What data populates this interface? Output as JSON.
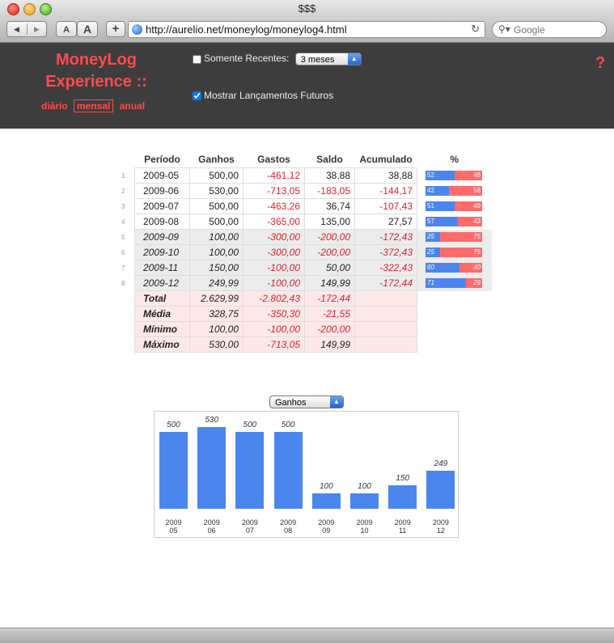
{
  "window": {
    "title": "$$$"
  },
  "toolbar": {
    "text_small": "A",
    "text_large": "A",
    "add_label": "+",
    "url": "http://aurelio.net/moneylog/moneylog4.html",
    "search_placeholder": "Google"
  },
  "header": {
    "logo_line1": "MoneyLog",
    "logo_line2": "Experience ::",
    "views": [
      "diário",
      "mensal",
      "anual"
    ],
    "active_view": "mensal",
    "recent_label": "Somente Recentes:",
    "recent_checked": false,
    "recent_value": "3 meses",
    "future_label": "Mostrar Lançamentos Futuros",
    "future_checked": true,
    "help": "?"
  },
  "table": {
    "headers": [
      "Período",
      "Ganhos",
      "Gastos",
      "Saldo",
      "Acumulado",
      "%"
    ],
    "rows": [
      {
        "n": "1",
        "period": "2009-05",
        "ganhos": "500,00",
        "gastos": "-461,12",
        "saldo": "38,88",
        "acumulado": "38,88",
        "g_pct": 52,
        "s_pct": 48,
        "future": false
      },
      {
        "n": "2",
        "period": "2009-06",
        "ganhos": "530,00",
        "gastos": "-713,05",
        "saldo": "-183,05",
        "acumulado": "-144,17",
        "g_pct": 42,
        "s_pct": 58,
        "future": false
      },
      {
        "n": "3",
        "period": "2009-07",
        "ganhos": "500,00",
        "gastos": "-463,26",
        "saldo": "36,74",
        "acumulado": "-107,43",
        "g_pct": 51,
        "s_pct": 49,
        "future": false
      },
      {
        "n": "4",
        "period": "2009-08",
        "ganhos": "500,00",
        "gastos": "-365,00",
        "saldo": "135,00",
        "acumulado": "27,57",
        "g_pct": 57,
        "s_pct": 43,
        "future": false
      },
      {
        "n": "5",
        "period": "2009-09",
        "ganhos": "100,00",
        "gastos": "-300,00",
        "saldo": "-200,00",
        "acumulado": "-172,43",
        "g_pct": 25,
        "s_pct": 75,
        "future": true
      },
      {
        "n": "6",
        "period": "2009-10",
        "ganhos": "100,00",
        "gastos": "-300,00",
        "saldo": "-200,00",
        "acumulado": "-372,43",
        "g_pct": 25,
        "s_pct": 75,
        "future": true
      },
      {
        "n": "7",
        "period": "2009-11",
        "ganhos": "150,00",
        "gastos": "-100,00",
        "saldo": "50,00",
        "acumulado": "-322,43",
        "g_pct": 60,
        "s_pct": 40,
        "future": true
      },
      {
        "n": "8",
        "period": "2009-12",
        "ganhos": "249,99",
        "gastos": "-100,00",
        "saldo": "149,99",
        "acumulado": "-172,44",
        "g_pct": 71,
        "s_pct": 29,
        "future": true
      }
    ],
    "summary": [
      {
        "label": "Total",
        "ganhos": "2.629,99",
        "gastos": "-2.802,43",
        "saldo": "-172,44"
      },
      {
        "label": "Média",
        "ganhos": "328,75",
        "gastos": "-350,30",
        "saldo": "-21,55"
      },
      {
        "label": "Mínimo",
        "ganhos": "100,00",
        "gastos": "-100,00",
        "saldo": "-200,00"
      },
      {
        "label": "Máximo",
        "ganhos": "530,00",
        "gastos": "-713,05",
        "saldo": "149,99"
      }
    ]
  },
  "chart_select": {
    "value": "Ganhos"
  },
  "colors": {
    "accent": "#ff4b4b",
    "ganhos": "#4b86ee",
    "gastos": "#ff6b6b",
    "negative": "#e0202a",
    "header_bg": "#3d3d3d"
  },
  "chart_data": {
    "type": "bar",
    "categories": [
      "2009\n05",
      "2009\n06",
      "2009\n07",
      "2009\n08",
      "2009\n09",
      "2009\n10",
      "2009\n11",
      "2009\n12"
    ],
    "values": [
      500,
      530,
      500,
      500,
      100,
      100,
      150,
      249
    ],
    "value_labels": [
      "500",
      "530",
      "500",
      "500",
      "100",
      "100",
      "150",
      "249"
    ],
    "title": "",
    "xlabel": "",
    "ylabel": "",
    "ylim": [
      0,
      530
    ],
    "grid": false
  }
}
